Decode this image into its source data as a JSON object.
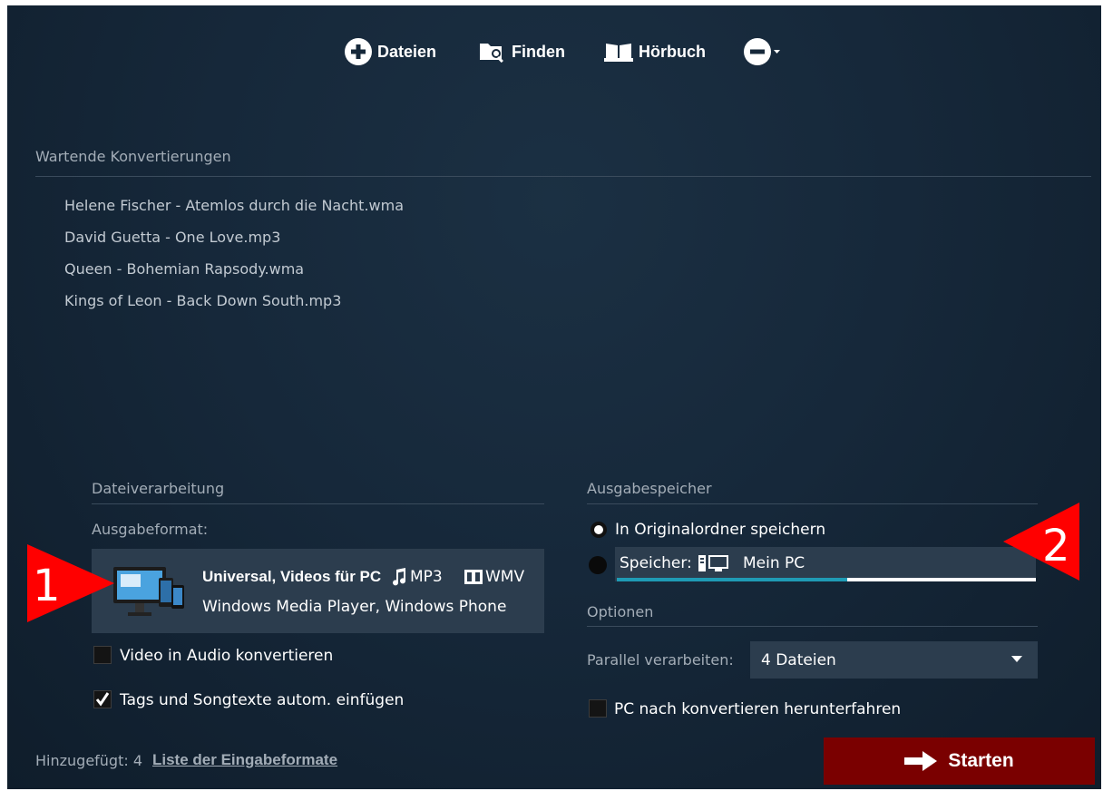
{
  "toolbar": {
    "files_label": "Dateien",
    "find_label": "Finden",
    "audiobook_label": "Hörbuch"
  },
  "queue": {
    "title": "Wartende Konvertierungen",
    "items": [
      "Helene Fischer - Atemlos durch die Nacht.wma",
      "David Guetta - One Love.mp3",
      "Queen - Bohemian Rapsody.wma",
      "Kings of Leon - Back Down South.mp3"
    ]
  },
  "processing": {
    "title": "Dateiverarbeitung",
    "output_format_label": "Ausgabeformat:",
    "format": {
      "name": "Universal, Videos für PC",
      "audio_codec": "MP3",
      "video_codec": "WMV",
      "devices": "Windows Media Player, Windows Phone"
    },
    "video_to_audio": {
      "label": "Video in Audio konvertieren",
      "checked": false
    },
    "tags": {
      "label": "Tags und Songtexte autom. einfügen",
      "checked": true
    }
  },
  "output": {
    "title": "Ausgabespeicher",
    "original_folder_label": "In Originalordner speichern",
    "storage_prefix": "Speicher:",
    "storage_value": "Mein PC",
    "storage_used_fraction": 0.55
  },
  "options": {
    "title": "Optionen",
    "parallel_label": "Parallel verarbeiten:",
    "parallel_value": "4 Dateien",
    "shutdown": {
      "label": "PC nach konvertieren herunterfahren",
      "checked": false
    }
  },
  "footer": {
    "added_text": "Hinzugefügt: 4",
    "formats_link": "Liste der Eingabeformate",
    "start_label": "Starten"
  },
  "annotations": {
    "marker_1": "1",
    "marker_2": "2"
  },
  "colors": {
    "background": "#16283a",
    "panel": "#2c3d4e",
    "start_button": "#7a0000",
    "annotation": "#ff0000",
    "progress": "#1f9bb5"
  }
}
